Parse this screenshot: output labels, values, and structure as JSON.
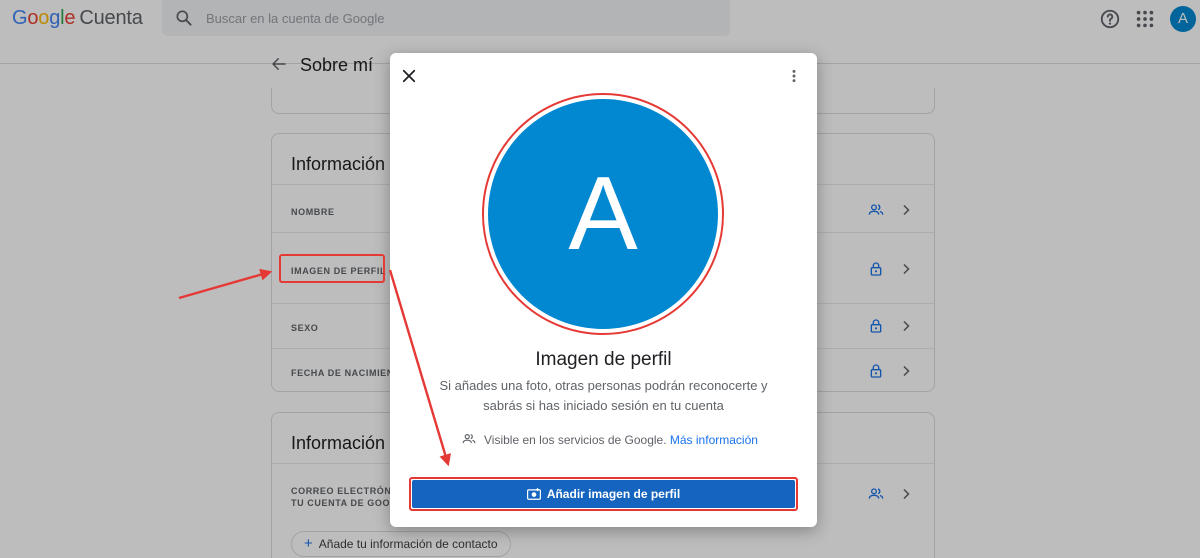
{
  "header": {
    "logo_letters": [
      "G",
      "o",
      "o",
      "g",
      "l",
      "e"
    ],
    "product": "Cuenta",
    "search_placeholder": "Buscar en la cuenta de Google",
    "avatar_letter": "A",
    "icons": [
      "search-icon",
      "help-icon",
      "apps-grid-icon",
      "avatar"
    ]
  },
  "page": {
    "title": "Sobre mí",
    "cards": [
      {
        "title": "Información",
        "rows": [
          {
            "label": "NOMBRE",
            "icon": "people-icon"
          },
          {
            "label": "IMAGEN DE PERFIL",
            "icon": "lock-icon"
          },
          {
            "label": "SEXO",
            "icon": "lock-icon"
          },
          {
            "label": "FECHA DE NACIMIENT",
            "icon": "lock-icon"
          }
        ]
      },
      {
        "title": "Información",
        "rows": [
          {
            "label_line1": "CORREO ELECTRÓNIC",
            "label_line2": "TU CUENTA DE GOOGL",
            "icon": "people-icon"
          }
        ],
        "add_contact": "Añade tu información de contacto"
      }
    ]
  },
  "modal": {
    "avatar_letter": "A",
    "title": "Imagen de perfil",
    "description": "Si añades una foto, otras personas podrán reconocerte y sabrás si has iniciado sesión en tu cuenta",
    "visibility_text": "Visible en los servicios de Google.",
    "more_info_link": "Más información",
    "add_button": "Añadir imagen de perfil"
  },
  "colors": {
    "accent_blue": "#1a73e8",
    "button_blue": "#1565c0",
    "avatar_blue": "#0288d1",
    "annotation_red": "#e53935"
  }
}
